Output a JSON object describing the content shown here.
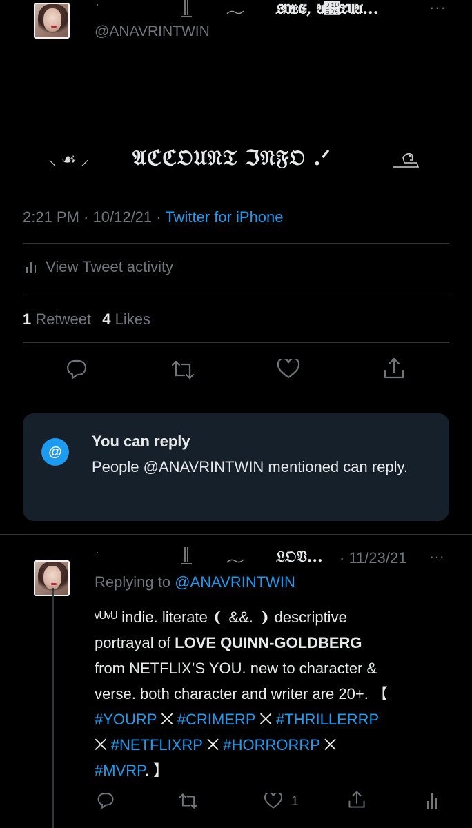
{
  "top_tweet": {
    "name": "𝔏𝔒𝔙𝔈, 𝔄𝔆𝔗𝔘𝔄...",
    "handle": "@ANAVRINTWIN",
    "name_decor": "·",
    "main_text": "𝔄ℭℭ𝔒𝔘𝔑𝔗 ℑ𝔑𝔉𝔒 .ᐟ",
    "main_prefix": "⸜ ☙ ⸝",
    "time": "2:21 PM",
    "date": "10/12/21",
    "source": "Twitter for iPhone",
    "activity_label": "View Tweet activity",
    "retweet_count": "1",
    "retweet_label": "Retweet",
    "like_count": "4",
    "like_label": "Likes"
  },
  "reply_card": {
    "title": "You can reply",
    "body": "People @ANAVRINTWIN mentioned can reply.",
    "icon_glyph": "@"
  },
  "reply_tweet": {
    "name": "𝔏𝔒𝔙...",
    "name_decor": "·",
    "date": "· 11/23/21",
    "replying_label": "Replying to",
    "replying_handle": "@ANAVRINTWIN",
    "line1": "ᵛᵁᵛᵁ indie. literate ❨ &&. ❩ descriptive",
    "line2_pre": "portrayal of ",
    "line2_bold": "LOVE QUINN-GOLDBERG",
    "line3": "from NETFLIX’S YOU. new to character &",
    "line4": "verse. both character and writer are 20+. 【",
    "line5_a": "#YOURP",
    "sep": " ⨉ ",
    "line5_b": "#CRIMERP",
    "line5_c": "#THRILLERRP",
    "line6_a": "#NETFLIXRP",
    "line6_b": "#HORRORRP",
    "line7_a": "#MVRP",
    "line7_end": ". 】",
    "like_count": "1"
  },
  "colors": {
    "background": "#000000",
    "text": "#e7e9ea",
    "muted": "#71767b",
    "accent": "#1d9bf0",
    "card": "#15202b"
  },
  "icons": [
    "more-icon",
    "activity-icon",
    "reply-icon",
    "retweet-icon",
    "like-icon",
    "share-icon",
    "at-icon",
    "analytics-icon"
  ]
}
